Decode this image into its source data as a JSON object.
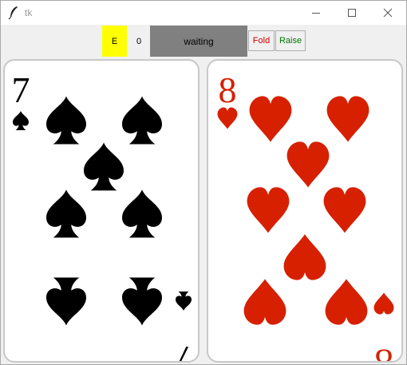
{
  "window": {
    "title": "tk",
    "icons": {
      "app": "feather-icon",
      "minimize": "minimize-icon",
      "maximize": "maximize-icon",
      "close": "close-icon"
    }
  },
  "toolbar": {
    "player_label": "E",
    "chip_count": "0",
    "status_text": "waiting",
    "fold_label": "Fold",
    "raise_label": "Raise"
  },
  "colors": {
    "player_highlight": "#ffff00",
    "status_bg": "#808080",
    "fold_text": "#cc0000",
    "raise_text": "#007700",
    "hearts": "#d62000",
    "spades": "#000000"
  },
  "cards": [
    {
      "rank": "7",
      "suit": "spades",
      "suit_icon": "spade-icon"
    },
    {
      "rank": "8",
      "suit": "hearts",
      "suit_icon": "heart-icon"
    }
  ]
}
